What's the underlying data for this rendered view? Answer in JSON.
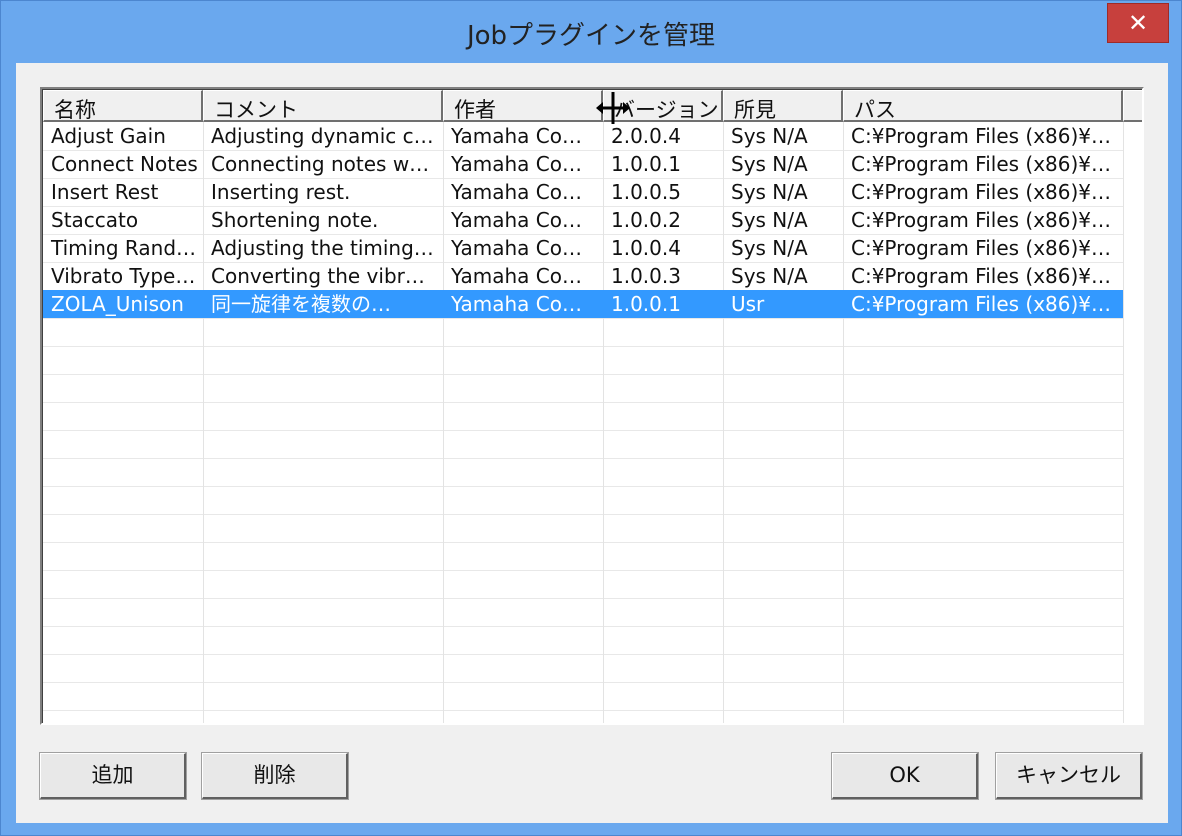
{
  "window": {
    "title": "Jobプラグインを管理",
    "close_glyph": "✕"
  },
  "table": {
    "columns": [
      "名称",
      "コメント",
      "作者",
      "バージョン",
      "所見",
      "パス"
    ],
    "rows": [
      [
        "Adjust Gain",
        "Adjusting dynamic c…",
        "Yamaha Co…",
        "2.0.0.4",
        "Sys N/A",
        "C:¥Program Files (x86)¥…"
      ],
      [
        "Connect Notes",
        "Connecting notes w…",
        "Yamaha Co…",
        "1.0.0.1",
        "Sys N/A",
        "C:¥Program Files (x86)¥…"
      ],
      [
        "Insert Rest",
        "Inserting rest.",
        "Yamaha Co…",
        "1.0.0.5",
        "Sys N/A",
        "C:¥Program Files (x86)¥…"
      ],
      [
        "Staccato",
        "Shortening note.",
        "Yamaha Co…",
        "1.0.0.2",
        "Sys N/A",
        "C:¥Program Files (x86)¥…"
      ],
      [
        "Timing Rand…",
        "Adjusting the timing…",
        "Yamaha Co…",
        "1.0.0.4",
        "Sys N/A",
        "C:¥Program Files (x86)¥…"
      ],
      [
        "Vibrato Type…",
        "Converting the vibr…",
        "Yamaha Co…",
        "1.0.0.3",
        "Sys N/A",
        "C:¥Program Files (x86)¥…"
      ],
      [
        "ZOLA_Unison",
        "同一旋律を複数の…",
        "Yamaha Co…",
        "1.0.0.1",
        "Usr",
        "C:¥Program Files (x86)¥…"
      ]
    ],
    "selected_row": 6
  },
  "buttons": {
    "add": "追加",
    "delete": "削除",
    "ok": "OK",
    "cancel": "キャンセル"
  },
  "colors": {
    "selection": "#3399ff",
    "title_bar": "#6aa8ee",
    "close_button": "#c7403d"
  },
  "icons": {
    "cursor": "column-resize-cursor-icon"
  }
}
